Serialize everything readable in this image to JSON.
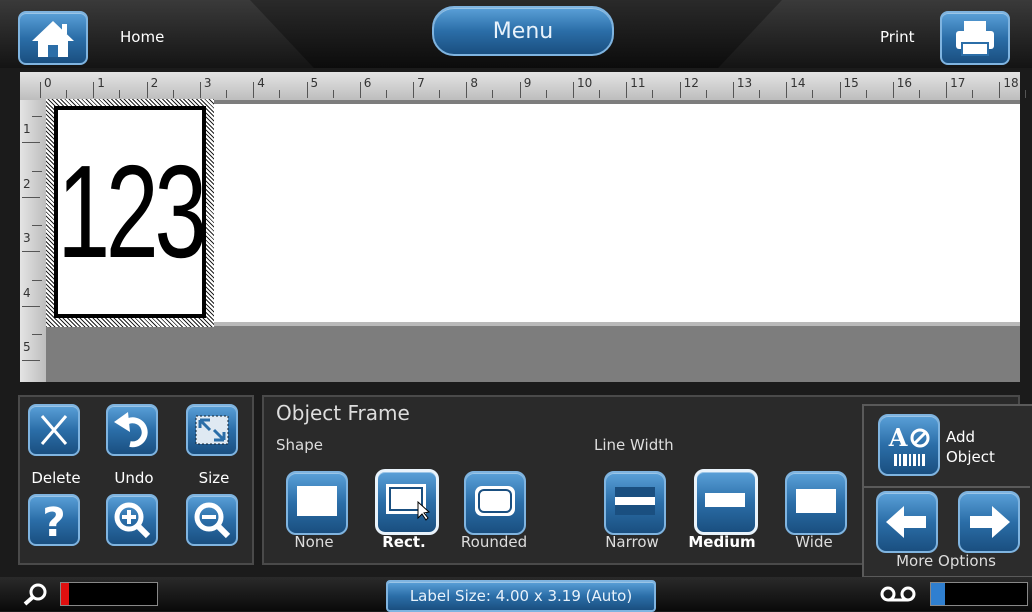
{
  "header": {
    "home_label": "Home",
    "menu_label": "Menu",
    "print_label": "Print"
  },
  "ruler": {
    "horizontal": [
      "0",
      "1",
      "2",
      "3",
      "4",
      "5",
      "6",
      "7",
      "8",
      "9",
      "10",
      "11",
      "12",
      "13",
      "14",
      "15",
      "16",
      "17",
      "18"
    ],
    "vertical": [
      "1",
      "2",
      "3",
      "4",
      "5"
    ]
  },
  "canvas": {
    "object_text": "123"
  },
  "actions": {
    "delete": "Delete",
    "undo": "Undo",
    "size": "Size"
  },
  "object_frame": {
    "title": "Object Frame",
    "shape_label": "Shape",
    "line_width_label": "Line Width",
    "shapes": [
      "None",
      "Rect.",
      "Rounded"
    ],
    "selected_shape": "Rect.",
    "widths": [
      "Narrow",
      "Medium",
      "Wide"
    ],
    "selected_width": "Medium"
  },
  "side": {
    "add_object": "Add Object",
    "more_options": "More Options"
  },
  "status": {
    "label_size": "Label Size: 4.00 x 3.19 (Auto)"
  },
  "colors": {
    "accent": "#2b6ea8",
    "meter_red": "#e01010",
    "meter_blue": "#2f7fd0"
  }
}
